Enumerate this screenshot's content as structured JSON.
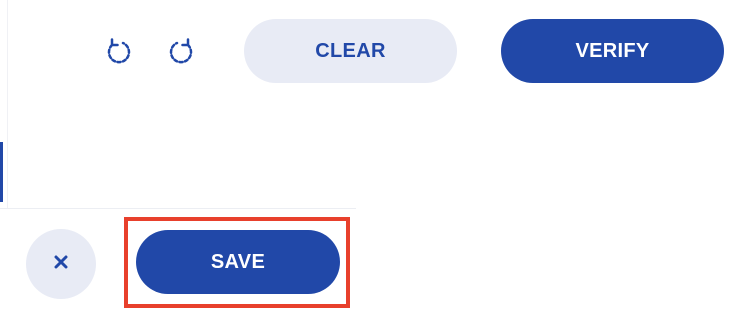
{
  "toolbar": {
    "undo_icon": "rotate-ccw-icon",
    "redo_icon": "rotate-cw-icon",
    "clear_label": "CLEAR",
    "verify_label": "VERIFY"
  },
  "footer": {
    "close_icon": "close-icon",
    "save_label": "SAVE"
  },
  "colors": {
    "primary": "#2148a8",
    "secondary_bg": "#e8ebf5",
    "highlight": "#e8402c"
  }
}
